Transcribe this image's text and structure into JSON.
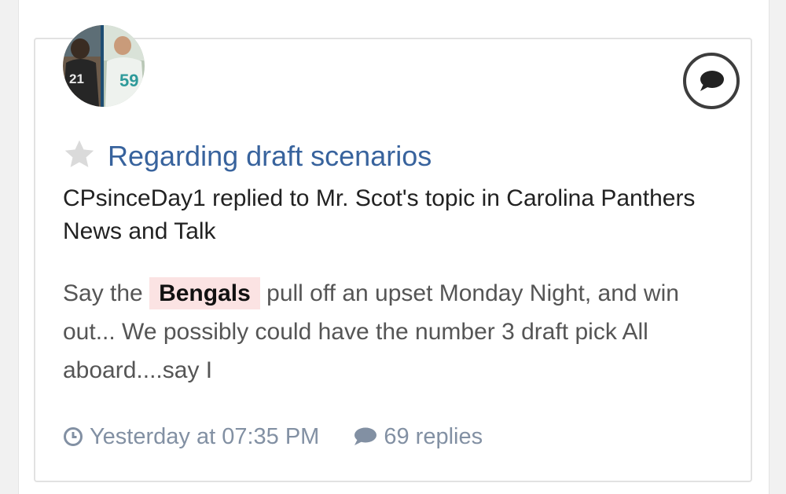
{
  "topic": {
    "title": "Regarding draft scenarios",
    "activity": "CPsinceDay1 replied to Mr. Scot's topic in Carolina Panthers News and Talk"
  },
  "excerpt": {
    "before": "Say the ",
    "highlight": "Bengals",
    "after": " pull off an upset Monday Night, and win out... We possibly could have the number 3 draft pick All aboard....say I"
  },
  "meta": {
    "timestamp": "Yesterday at 07:35 PM",
    "replies": "69 replies"
  },
  "avatar": {
    "jersey_left": "21",
    "jersey_right": "59"
  },
  "icons": {
    "star": "star-icon",
    "comment_badge": "speech-bubble-icon",
    "clock": "clock-icon",
    "replies": "comment-icon"
  },
  "colors": {
    "link": "#38639d",
    "meta": "#8290a3",
    "highlight_bg": "#fbe3e3"
  }
}
